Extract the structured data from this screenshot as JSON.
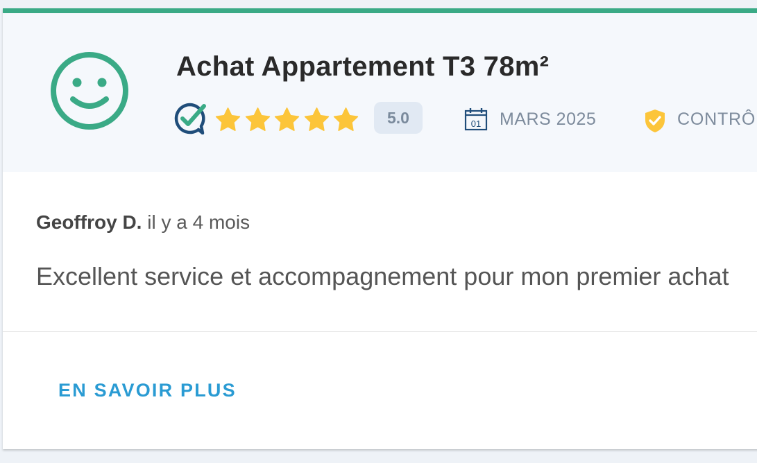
{
  "review": {
    "title": "Achat Appartement T3 78m²",
    "rating": "5.0",
    "stars": 5,
    "date": "MARS 2025",
    "calendar_day": "01",
    "verification": "CONTRÔL",
    "author": "Geoffroy D.",
    "time_ago": "il y a 4 mois",
    "comment": "Excellent service et accompagnement pour mon premier achat",
    "more_label": "EN SAVOIR PLUS"
  },
  "icons": {
    "mood": "smiley-icon",
    "verified": "verified-review-icon",
    "star": "star-icon",
    "calendar": "calendar-icon",
    "shield": "shield-check-icon"
  },
  "colors": {
    "accent_green": "#3aaa86",
    "star_yellow": "#fcc53a",
    "link_blue": "#2a9bd3",
    "navy": "#1f4d7a"
  }
}
